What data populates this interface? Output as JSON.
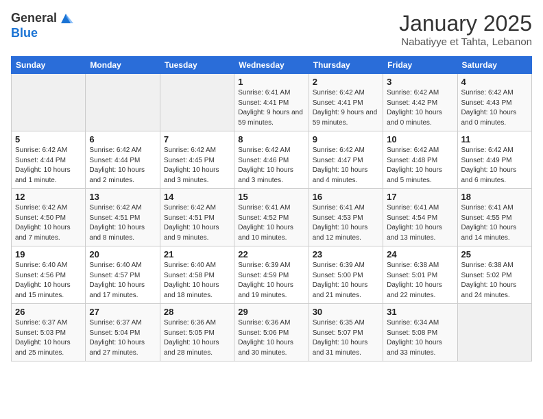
{
  "header": {
    "logo_line1": "General",
    "logo_line2": "Blue",
    "title": "January 2025",
    "subtitle": "Nabatiyye et Tahta, Lebanon"
  },
  "days_of_week": [
    "Sunday",
    "Monday",
    "Tuesday",
    "Wednesday",
    "Thursday",
    "Friday",
    "Saturday"
  ],
  "weeks": [
    [
      {
        "day": "",
        "info": ""
      },
      {
        "day": "",
        "info": ""
      },
      {
        "day": "",
        "info": ""
      },
      {
        "day": "1",
        "info": "Sunrise: 6:41 AM\nSunset: 4:41 PM\nDaylight: 9 hours and 59 minutes."
      },
      {
        "day": "2",
        "info": "Sunrise: 6:42 AM\nSunset: 4:41 PM\nDaylight: 9 hours and 59 minutes."
      },
      {
        "day": "3",
        "info": "Sunrise: 6:42 AM\nSunset: 4:42 PM\nDaylight: 10 hours and 0 minutes."
      },
      {
        "day": "4",
        "info": "Sunrise: 6:42 AM\nSunset: 4:43 PM\nDaylight: 10 hours and 0 minutes."
      }
    ],
    [
      {
        "day": "5",
        "info": "Sunrise: 6:42 AM\nSunset: 4:44 PM\nDaylight: 10 hours and 1 minute."
      },
      {
        "day": "6",
        "info": "Sunrise: 6:42 AM\nSunset: 4:44 PM\nDaylight: 10 hours and 2 minutes."
      },
      {
        "day": "7",
        "info": "Sunrise: 6:42 AM\nSunset: 4:45 PM\nDaylight: 10 hours and 3 minutes."
      },
      {
        "day": "8",
        "info": "Sunrise: 6:42 AM\nSunset: 4:46 PM\nDaylight: 10 hours and 3 minutes."
      },
      {
        "day": "9",
        "info": "Sunrise: 6:42 AM\nSunset: 4:47 PM\nDaylight: 10 hours and 4 minutes."
      },
      {
        "day": "10",
        "info": "Sunrise: 6:42 AM\nSunset: 4:48 PM\nDaylight: 10 hours and 5 minutes."
      },
      {
        "day": "11",
        "info": "Sunrise: 6:42 AM\nSunset: 4:49 PM\nDaylight: 10 hours and 6 minutes."
      }
    ],
    [
      {
        "day": "12",
        "info": "Sunrise: 6:42 AM\nSunset: 4:50 PM\nDaylight: 10 hours and 7 minutes."
      },
      {
        "day": "13",
        "info": "Sunrise: 6:42 AM\nSunset: 4:51 PM\nDaylight: 10 hours and 8 minutes."
      },
      {
        "day": "14",
        "info": "Sunrise: 6:42 AM\nSunset: 4:51 PM\nDaylight: 10 hours and 9 minutes."
      },
      {
        "day": "15",
        "info": "Sunrise: 6:41 AM\nSunset: 4:52 PM\nDaylight: 10 hours and 10 minutes."
      },
      {
        "day": "16",
        "info": "Sunrise: 6:41 AM\nSunset: 4:53 PM\nDaylight: 10 hours and 12 minutes."
      },
      {
        "day": "17",
        "info": "Sunrise: 6:41 AM\nSunset: 4:54 PM\nDaylight: 10 hours and 13 minutes."
      },
      {
        "day": "18",
        "info": "Sunrise: 6:41 AM\nSunset: 4:55 PM\nDaylight: 10 hours and 14 minutes."
      }
    ],
    [
      {
        "day": "19",
        "info": "Sunrise: 6:40 AM\nSunset: 4:56 PM\nDaylight: 10 hours and 15 minutes."
      },
      {
        "day": "20",
        "info": "Sunrise: 6:40 AM\nSunset: 4:57 PM\nDaylight: 10 hours and 17 minutes."
      },
      {
        "day": "21",
        "info": "Sunrise: 6:40 AM\nSunset: 4:58 PM\nDaylight: 10 hours and 18 minutes."
      },
      {
        "day": "22",
        "info": "Sunrise: 6:39 AM\nSunset: 4:59 PM\nDaylight: 10 hours and 19 minutes."
      },
      {
        "day": "23",
        "info": "Sunrise: 6:39 AM\nSunset: 5:00 PM\nDaylight: 10 hours and 21 minutes."
      },
      {
        "day": "24",
        "info": "Sunrise: 6:38 AM\nSunset: 5:01 PM\nDaylight: 10 hours and 22 minutes."
      },
      {
        "day": "25",
        "info": "Sunrise: 6:38 AM\nSunset: 5:02 PM\nDaylight: 10 hours and 24 minutes."
      }
    ],
    [
      {
        "day": "26",
        "info": "Sunrise: 6:37 AM\nSunset: 5:03 PM\nDaylight: 10 hours and 25 minutes."
      },
      {
        "day": "27",
        "info": "Sunrise: 6:37 AM\nSunset: 5:04 PM\nDaylight: 10 hours and 27 minutes."
      },
      {
        "day": "28",
        "info": "Sunrise: 6:36 AM\nSunset: 5:05 PM\nDaylight: 10 hours and 28 minutes."
      },
      {
        "day": "29",
        "info": "Sunrise: 6:36 AM\nSunset: 5:06 PM\nDaylight: 10 hours and 30 minutes."
      },
      {
        "day": "30",
        "info": "Sunrise: 6:35 AM\nSunset: 5:07 PM\nDaylight: 10 hours and 31 minutes."
      },
      {
        "day": "31",
        "info": "Sunrise: 6:34 AM\nSunset: 5:08 PM\nDaylight: 10 hours and 33 minutes."
      },
      {
        "day": "",
        "info": ""
      }
    ]
  ]
}
